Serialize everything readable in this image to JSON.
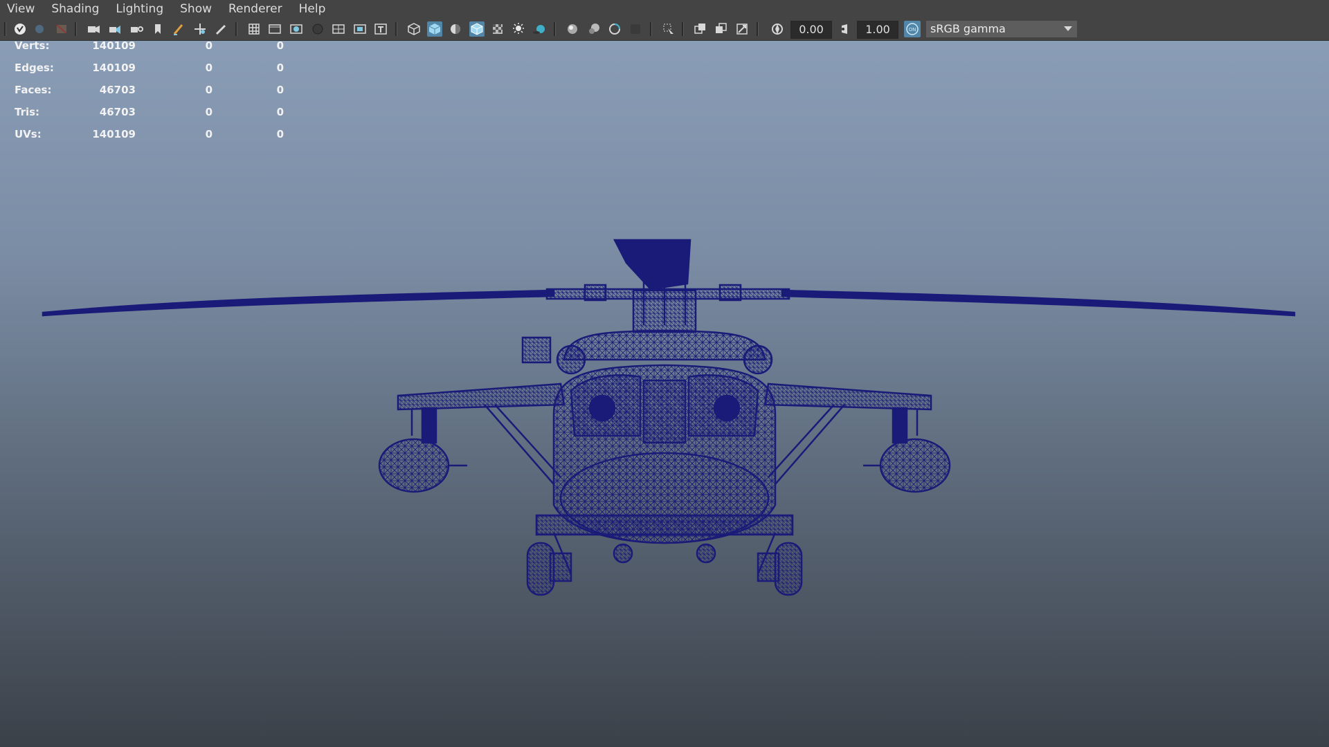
{
  "menu": [
    "View",
    "Shading",
    "Lighting",
    "Show",
    "Renderer",
    "Help"
  ],
  "toolbar": {
    "exposure_value": "0.00",
    "gamma_value": "1.00",
    "color_management_badge": "ON",
    "color_space": "sRGB gamma"
  },
  "hud": {
    "rows": [
      {
        "label": "Verts:",
        "v1": "140109",
        "v2": "0",
        "v3": "0"
      },
      {
        "label": "Edges:",
        "v1": "140109",
        "v2": "0",
        "v3": "0"
      },
      {
        "label": "Faces:",
        "v1": "46703",
        "v2": "0",
        "v3": "0"
      },
      {
        "label": "Tris:",
        "v1": "46703",
        "v2": "0",
        "v3": "0"
      },
      {
        "label": "UVs:",
        "v1": "140109",
        "v2": "0",
        "v3": "0"
      }
    ]
  },
  "colors": {
    "menubar_bg": "#444444",
    "accent": "#5286a8",
    "wireframe": "#1a1a78",
    "viewport_top": "#8a9db6",
    "viewport_bottom": "#3b4149"
  },
  "icons": [
    "select-camera-icon",
    "lock-camera-icon",
    "camera-attributes-icon",
    "bookmark-icon",
    "camera-view-icon",
    "image-plane-icon",
    "2d-pan-zoom-icon",
    "grease-pencil-icon",
    "grid-icon",
    "film-gate-icon",
    "resolution-gate-icon",
    "gate-mask-icon",
    "field-chart-icon",
    "safe-action-icon",
    "safe-title-icon",
    "wireframe-icon",
    "smooth-shade-icon",
    "default-material-icon",
    "wireframe-on-shaded-icon",
    "textured-icon",
    "use-all-lights-icon",
    "shadows-icon",
    "screen-space-ao-icon",
    "motion-blur-icon",
    "anti-aliasing-icon",
    "depth-of-field-icon",
    "isolate-select-icon",
    "xray-icon",
    "xray-active-components-icon",
    "xray-joints-icon",
    "exposure-icon",
    "gamma-icon",
    "color-management-icon"
  ]
}
